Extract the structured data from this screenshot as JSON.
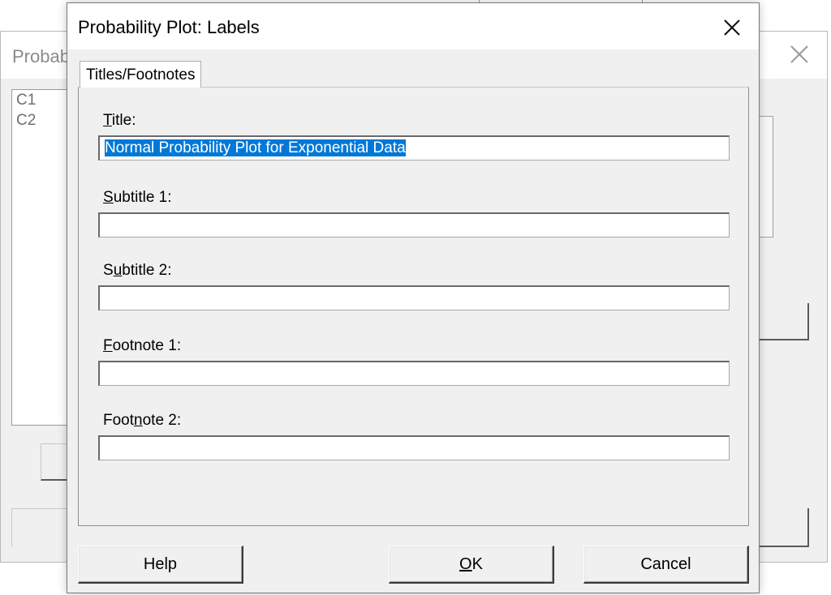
{
  "background_dialog": {
    "title": "Probab",
    "list_items": [
      "C1",
      "C2"
    ]
  },
  "dialog": {
    "title": "Probability Plot: Labels",
    "tab_label": "Titles/Footnotes",
    "fields": [
      {
        "label_pre": "",
        "label_key": "T",
        "label_post": "itle:",
        "value": "Normal Probability Plot for Exponential Data"
      },
      {
        "label_pre": "",
        "label_key": "S",
        "label_post": "ubtitle 1:",
        "value": ""
      },
      {
        "label_pre": "S",
        "label_key": "u",
        "label_post": "btitle 2:",
        "value": ""
      },
      {
        "label_pre": "",
        "label_key": "F",
        "label_post": "ootnote 1:",
        "value": ""
      },
      {
        "label_pre": "Foot",
        "label_key": "n",
        "label_post": "ote 2:",
        "value": ""
      }
    ],
    "buttons": {
      "help": "Help",
      "ok_key": "O",
      "ok_rest": "K",
      "cancel": "Cancel"
    }
  },
  "colors": {
    "selection": "#0078d7",
    "dialog_bg": "#f0f0f0"
  },
  "icons": {
    "close": "close-icon"
  }
}
